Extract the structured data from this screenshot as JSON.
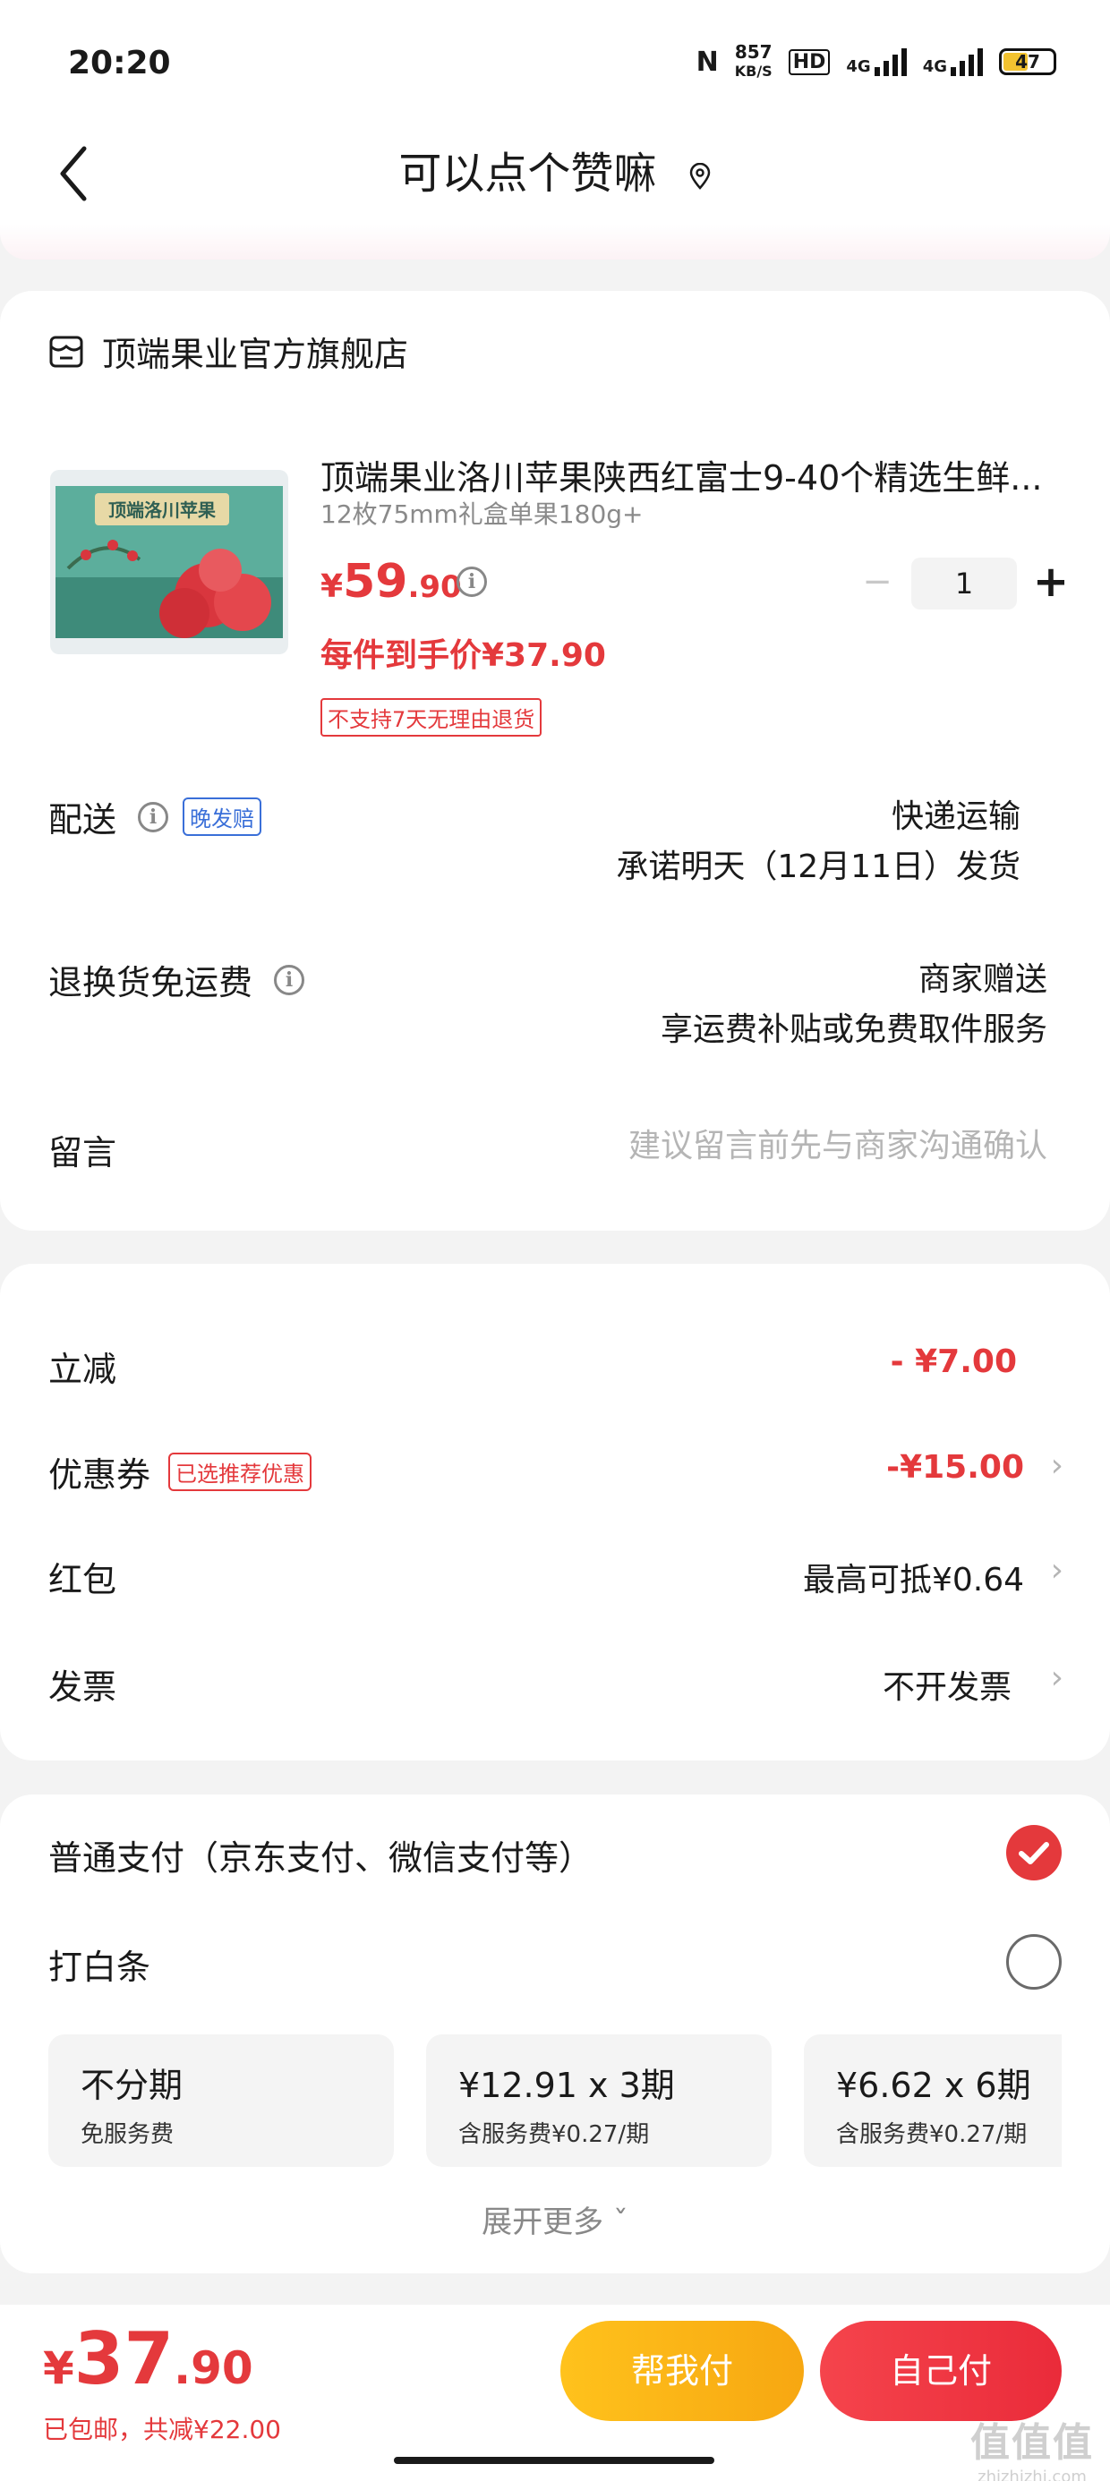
{
  "status_bar": {
    "time": "20:20",
    "net_speed_value": "857",
    "net_speed_unit": "KB/S",
    "hd": "HD",
    "net1": "4G",
    "net2": "4G",
    "battery": "47"
  },
  "nav": {
    "title": "可以点个赞嘛",
    "back_icon": "chevron-left-icon",
    "location_icon": "location-pin-icon"
  },
  "shop": {
    "name": "顶端果业官方旗舰店",
    "icon": "shop-icon"
  },
  "product": {
    "image_text": "顶端洛川苹果",
    "name": "顶端果业洛川苹果陕西红富士9-40个精选生鲜...",
    "spec": "12枚75mm礼盒单果180g+",
    "price_currency": "¥",
    "price_int": "59",
    "price_dec": ".90",
    "quantity": "1",
    "minus": "−",
    "plus": "+",
    "unit_final_price": "每件到手价¥37.90",
    "return_tag": "不支持7天无理由退货"
  },
  "delivery": {
    "label": "配送",
    "tag": "晚发赔",
    "method": "快递运输",
    "promise": "承诺明天（12月11日）发货"
  },
  "return_shipping": {
    "label": "退换货免运费",
    "value1": "商家赠送",
    "value2": "享运费补贴或免费取件服务"
  },
  "message": {
    "label": "留言",
    "placeholder": "建议留言前先与商家沟通确认"
  },
  "discounts": {
    "instant": {
      "label": "立减",
      "value": "- ¥7.00"
    },
    "coupon": {
      "label": "优惠券",
      "tag": "已选推荐优惠",
      "value": "-¥15.00"
    },
    "red_packet": {
      "label": "红包",
      "value": "最高可抵¥0.64"
    },
    "invoice": {
      "label": "发票",
      "value": "不开发票"
    },
    "chevron": "›"
  },
  "payment": {
    "normal": {
      "label": "普通支付（京东支付、微信支付等）",
      "selected": true
    },
    "baitiao": {
      "label": "打白条",
      "selected": false
    },
    "plans": [
      {
        "title": "不分期",
        "sub": "免服务费"
      },
      {
        "title": "¥12.91 x 3期",
        "sub": "含服务费¥0.27/期"
      },
      {
        "title": "¥6.62 x 6期",
        "sub": "含服务费¥0.27/期"
      }
    ],
    "expand": "展开更多 ˇ"
  },
  "bottom": {
    "total_currency": "¥",
    "total_int": "37",
    "total_dec": ".90",
    "note": "已包邮，共减¥22.00",
    "help_pay": "帮我付",
    "self_pay": "自己付"
  },
  "watermark": {
    "big": "值值值",
    "small": "zhizhizhi.com"
  },
  "colors": {
    "accent_red": "#e4393c",
    "help_yellow": "#f7a711",
    "tag_blue": "#3a6fd8"
  }
}
